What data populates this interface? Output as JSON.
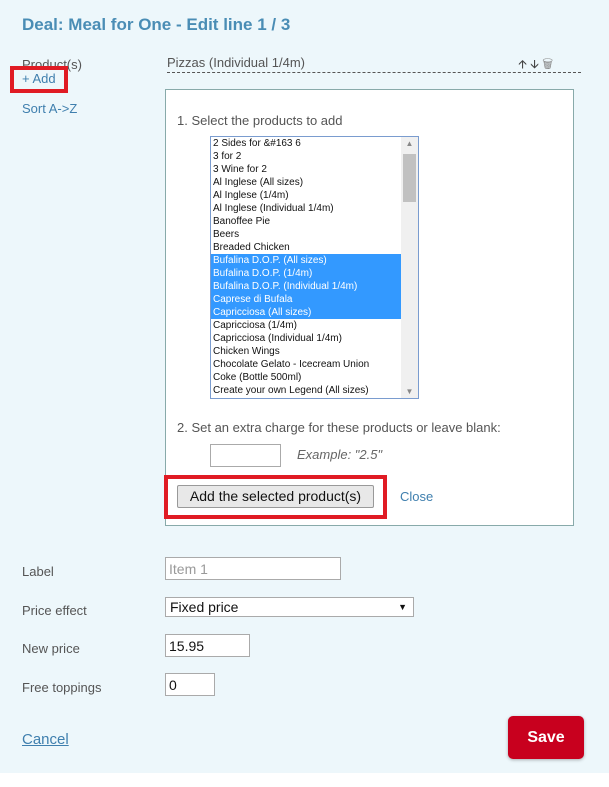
{
  "title": "Deal: Meal for One - Edit line 1 / 3",
  "sidebar": {
    "products_label": "Product(s)",
    "add_link": "+ Add",
    "sort_link": "Sort A->Z"
  },
  "product_line": {
    "name": "Pizzas (Individual 1/4m)",
    "icons": [
      "arrow-up-icon",
      "arrow-down-icon",
      "trash-icon"
    ]
  },
  "add_panel": {
    "step1": "1. Select the products to add",
    "options": [
      {
        "label": "2 Sides for &#163 6",
        "selected": false
      },
      {
        "label": "3 for 2",
        "selected": false
      },
      {
        "label": "3 Wine for 2",
        "selected": false
      },
      {
        "label": "Al Inglese (All sizes)",
        "selected": false
      },
      {
        "label": "Al Inglese (1/4m)",
        "selected": false
      },
      {
        "label": "Al Inglese (Individual 1/4m)",
        "selected": false
      },
      {
        "label": "Banoffee Pie",
        "selected": false
      },
      {
        "label": "Beers",
        "selected": false
      },
      {
        "label": "Breaded Chicken",
        "selected": false
      },
      {
        "label": "Bufalina D.O.P. (All sizes)",
        "selected": true
      },
      {
        "label": "Bufalina D.O.P. (1/4m)",
        "selected": true
      },
      {
        "label": "Bufalina D.O.P. (Individual 1/4m)",
        "selected": true
      },
      {
        "label": "Caprese di Bufala",
        "selected": true
      },
      {
        "label": "Capricciosa (All sizes)",
        "selected": true
      },
      {
        "label": "Capricciosa (1/4m)",
        "selected": false
      },
      {
        "label": "Capricciosa (Individual 1/4m)",
        "selected": false
      },
      {
        "label": "Chicken Wings",
        "selected": false
      },
      {
        "label": "Chocolate Gelato - Icecream Union",
        "selected": false
      },
      {
        "label": "Coke (Bottle 500ml)",
        "selected": false
      },
      {
        "label": "Create your own Legend (All sizes)",
        "selected": false
      }
    ],
    "step2": "2. Set an extra charge for these products or leave blank:",
    "charge_value": "",
    "example": "Example: \"2.5\"",
    "add_button": "Add the selected product(s)",
    "close_link": "Close"
  },
  "form": {
    "label_label": "Label",
    "label_placeholder": "Item 1",
    "price_effect_label": "Price effect",
    "price_effect_value": "Fixed price",
    "new_price_label": "New price",
    "new_price_value": "15.95",
    "free_toppings_label": "Free toppings",
    "free_toppings_value": "0"
  },
  "footer": {
    "cancel": "Cancel",
    "save": "Save"
  },
  "colors": {
    "accent": "#4a8db5",
    "save": "#c8001e",
    "highlight": "#e01b24",
    "selection": "#3399ff"
  }
}
